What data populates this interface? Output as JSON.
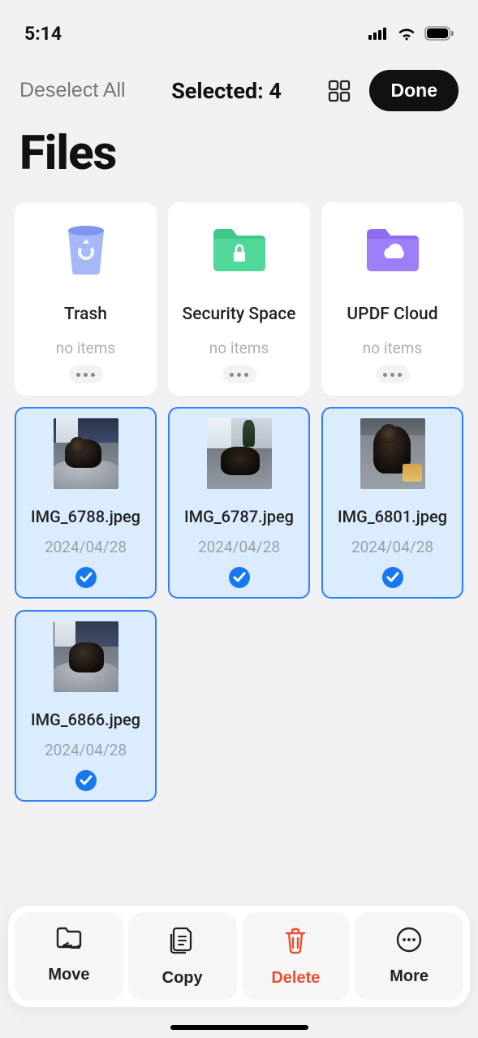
{
  "status": {
    "time": "5:14"
  },
  "topbar": {
    "deselect_label": "Deselect All",
    "selected_label": "Selected: 4",
    "done_label": "Done"
  },
  "title": "Files",
  "folders": [
    {
      "name": "Trash",
      "sub": "no items",
      "icon": "trash"
    },
    {
      "name": "Security Space",
      "sub": "no items",
      "icon": "lock"
    },
    {
      "name": "UPDF Cloud",
      "sub": "no items",
      "icon": "cloud"
    }
  ],
  "files": [
    {
      "name": "IMG_6788.jpeg",
      "date": "2024/04/28",
      "selected": true
    },
    {
      "name": "IMG_6787.jpeg",
      "date": "2024/04/28",
      "selected": true
    },
    {
      "name": "IMG_6801.jpeg",
      "date": "2024/04/28",
      "selected": true
    },
    {
      "name": "IMG_6866.jpeg",
      "date": "2024/04/28",
      "selected": true
    }
  ],
  "actions": {
    "move": "Move",
    "copy": "Copy",
    "delete": "Delete",
    "more": "More"
  },
  "colors": {
    "accent": "#2f7efb",
    "selected_bg": "#dcecff",
    "danger": "#e85130",
    "folder_green": "#3ec98b",
    "folder_purple": "#8d6cf0",
    "trash_blue": "#8da5f2"
  }
}
